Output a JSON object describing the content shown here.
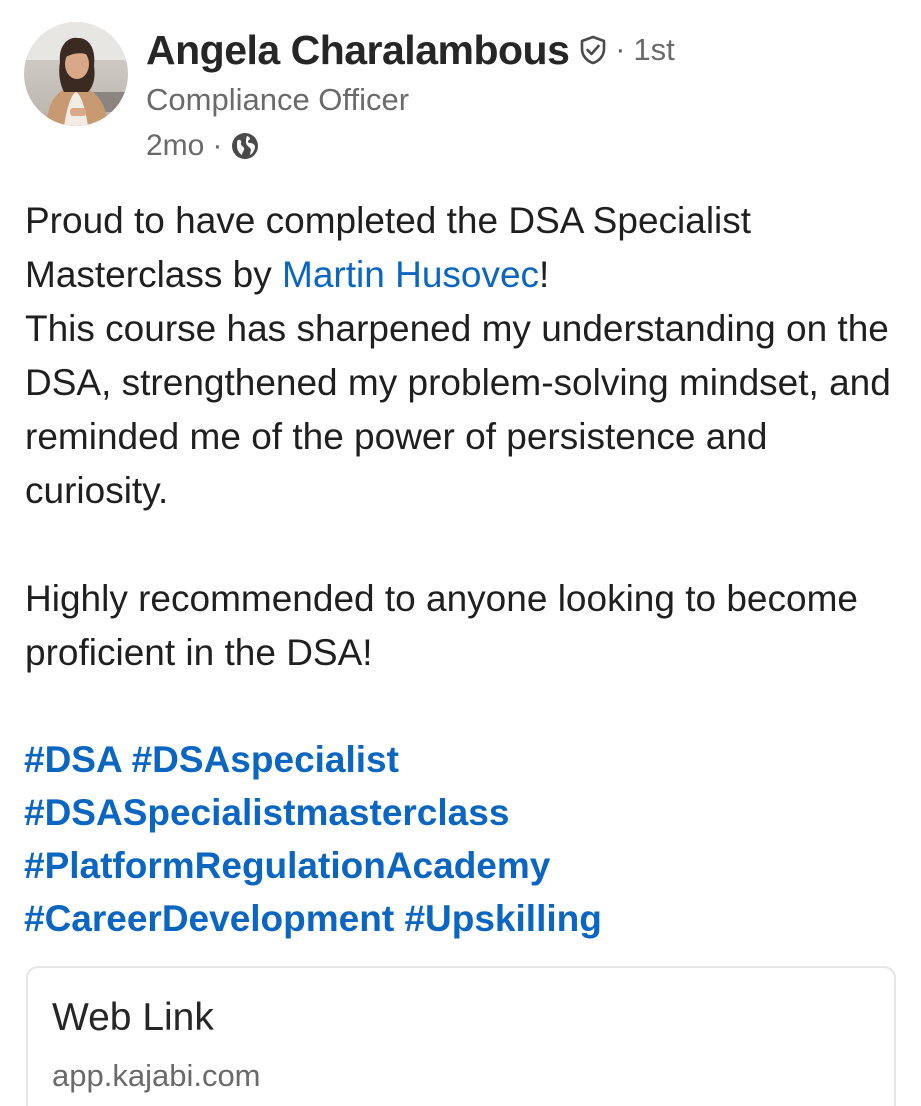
{
  "author": {
    "name": "Angela Charalambous",
    "connection_degree": "1st",
    "headline": "Compliance Officer",
    "posted_ago": "2mo",
    "visibility_icon": "globe-icon",
    "verified_icon": "verified-shield-icon"
  },
  "post": {
    "line1_before_mention": "Proud to have completed the DSA Specialist Masterclass by ",
    "mention": "Martin Husovec",
    "line1_after_mention": "!",
    "paragraph1_rest": "This course has sharpened my understanding on the DSA, strengthened my problem-solving mindset, and reminded me of the power of persistence and curiosity.",
    "paragraph2": "Highly recommended to anyone looking to become proficient in the DSA!",
    "hashtags": [
      "#DSA",
      "#DSAspecialist",
      "#DSASpecialistmasterclass",
      "#PlatformRegulationAcademy",
      "#CareerDevelopment",
      "#Upskilling"
    ]
  },
  "link_card": {
    "title": "Web Link",
    "domain": "app.kajabi.com"
  },
  "colors": {
    "link_blue": "#0a66c2",
    "secondary_text": "#6a6a6a",
    "primary_text": "#1f1f1f"
  }
}
